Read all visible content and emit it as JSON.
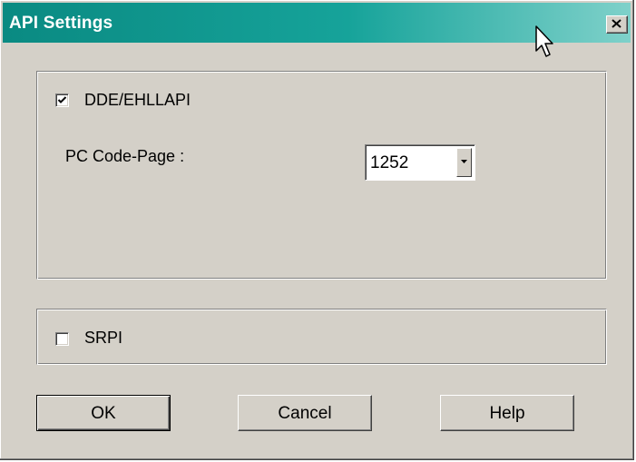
{
  "window": {
    "title": "API Settings",
    "close_icon": "close-icon"
  },
  "dde_group": {
    "checkbox_label": "DDE/EHLLAPI",
    "checked": true,
    "code_page_label": "PC Code-Page :",
    "code_page_value": "1252"
  },
  "srpi_group": {
    "checkbox_label": "SRPI",
    "checked": false
  },
  "buttons": {
    "ok": "OK",
    "cancel": "Cancel",
    "help": "Help"
  },
  "colors": {
    "title_bar": "#0a8a82",
    "dialog_face": "#d4d0c8"
  }
}
